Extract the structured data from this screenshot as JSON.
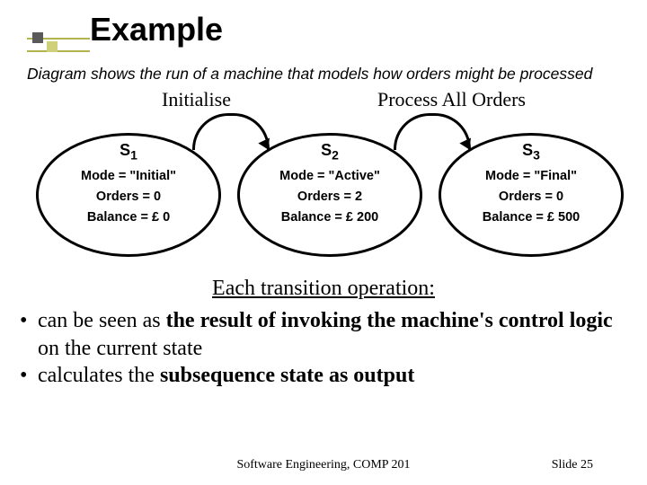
{
  "title": "Example",
  "description": "Diagram shows the run of a machine that models how orders might be processed",
  "transitions": [
    "Initialise",
    "Process All Orders"
  ],
  "states": [
    {
      "name": "S",
      "sub": "1",
      "mode": "Mode = \"Initial\"",
      "orders": "Orders = 0",
      "balance": "Balance = £ 0"
    },
    {
      "name": "S",
      "sub": "2",
      "mode": "Mode = \"Active\"",
      "orders": "Orders = 2",
      "balance": "Balance = £ 200"
    },
    {
      "name": "S",
      "sub": "3",
      "mode": "Mode = \"Final\"",
      "orders": "Orders = 0",
      "balance": "Balance = £ 500"
    }
  ],
  "lead": "Each transition operation:",
  "bullets": [
    {
      "pre": "can be seen as ",
      "bold": "the result of invoking the  machine's control logic",
      "post": " on the current state"
    },
    {
      "pre": "calculates the ",
      "bold": "subsequence state as output",
      "post": ""
    }
  ],
  "footer_left": "Software Engineering, COMP 201",
  "footer_right": "Slide  25"
}
